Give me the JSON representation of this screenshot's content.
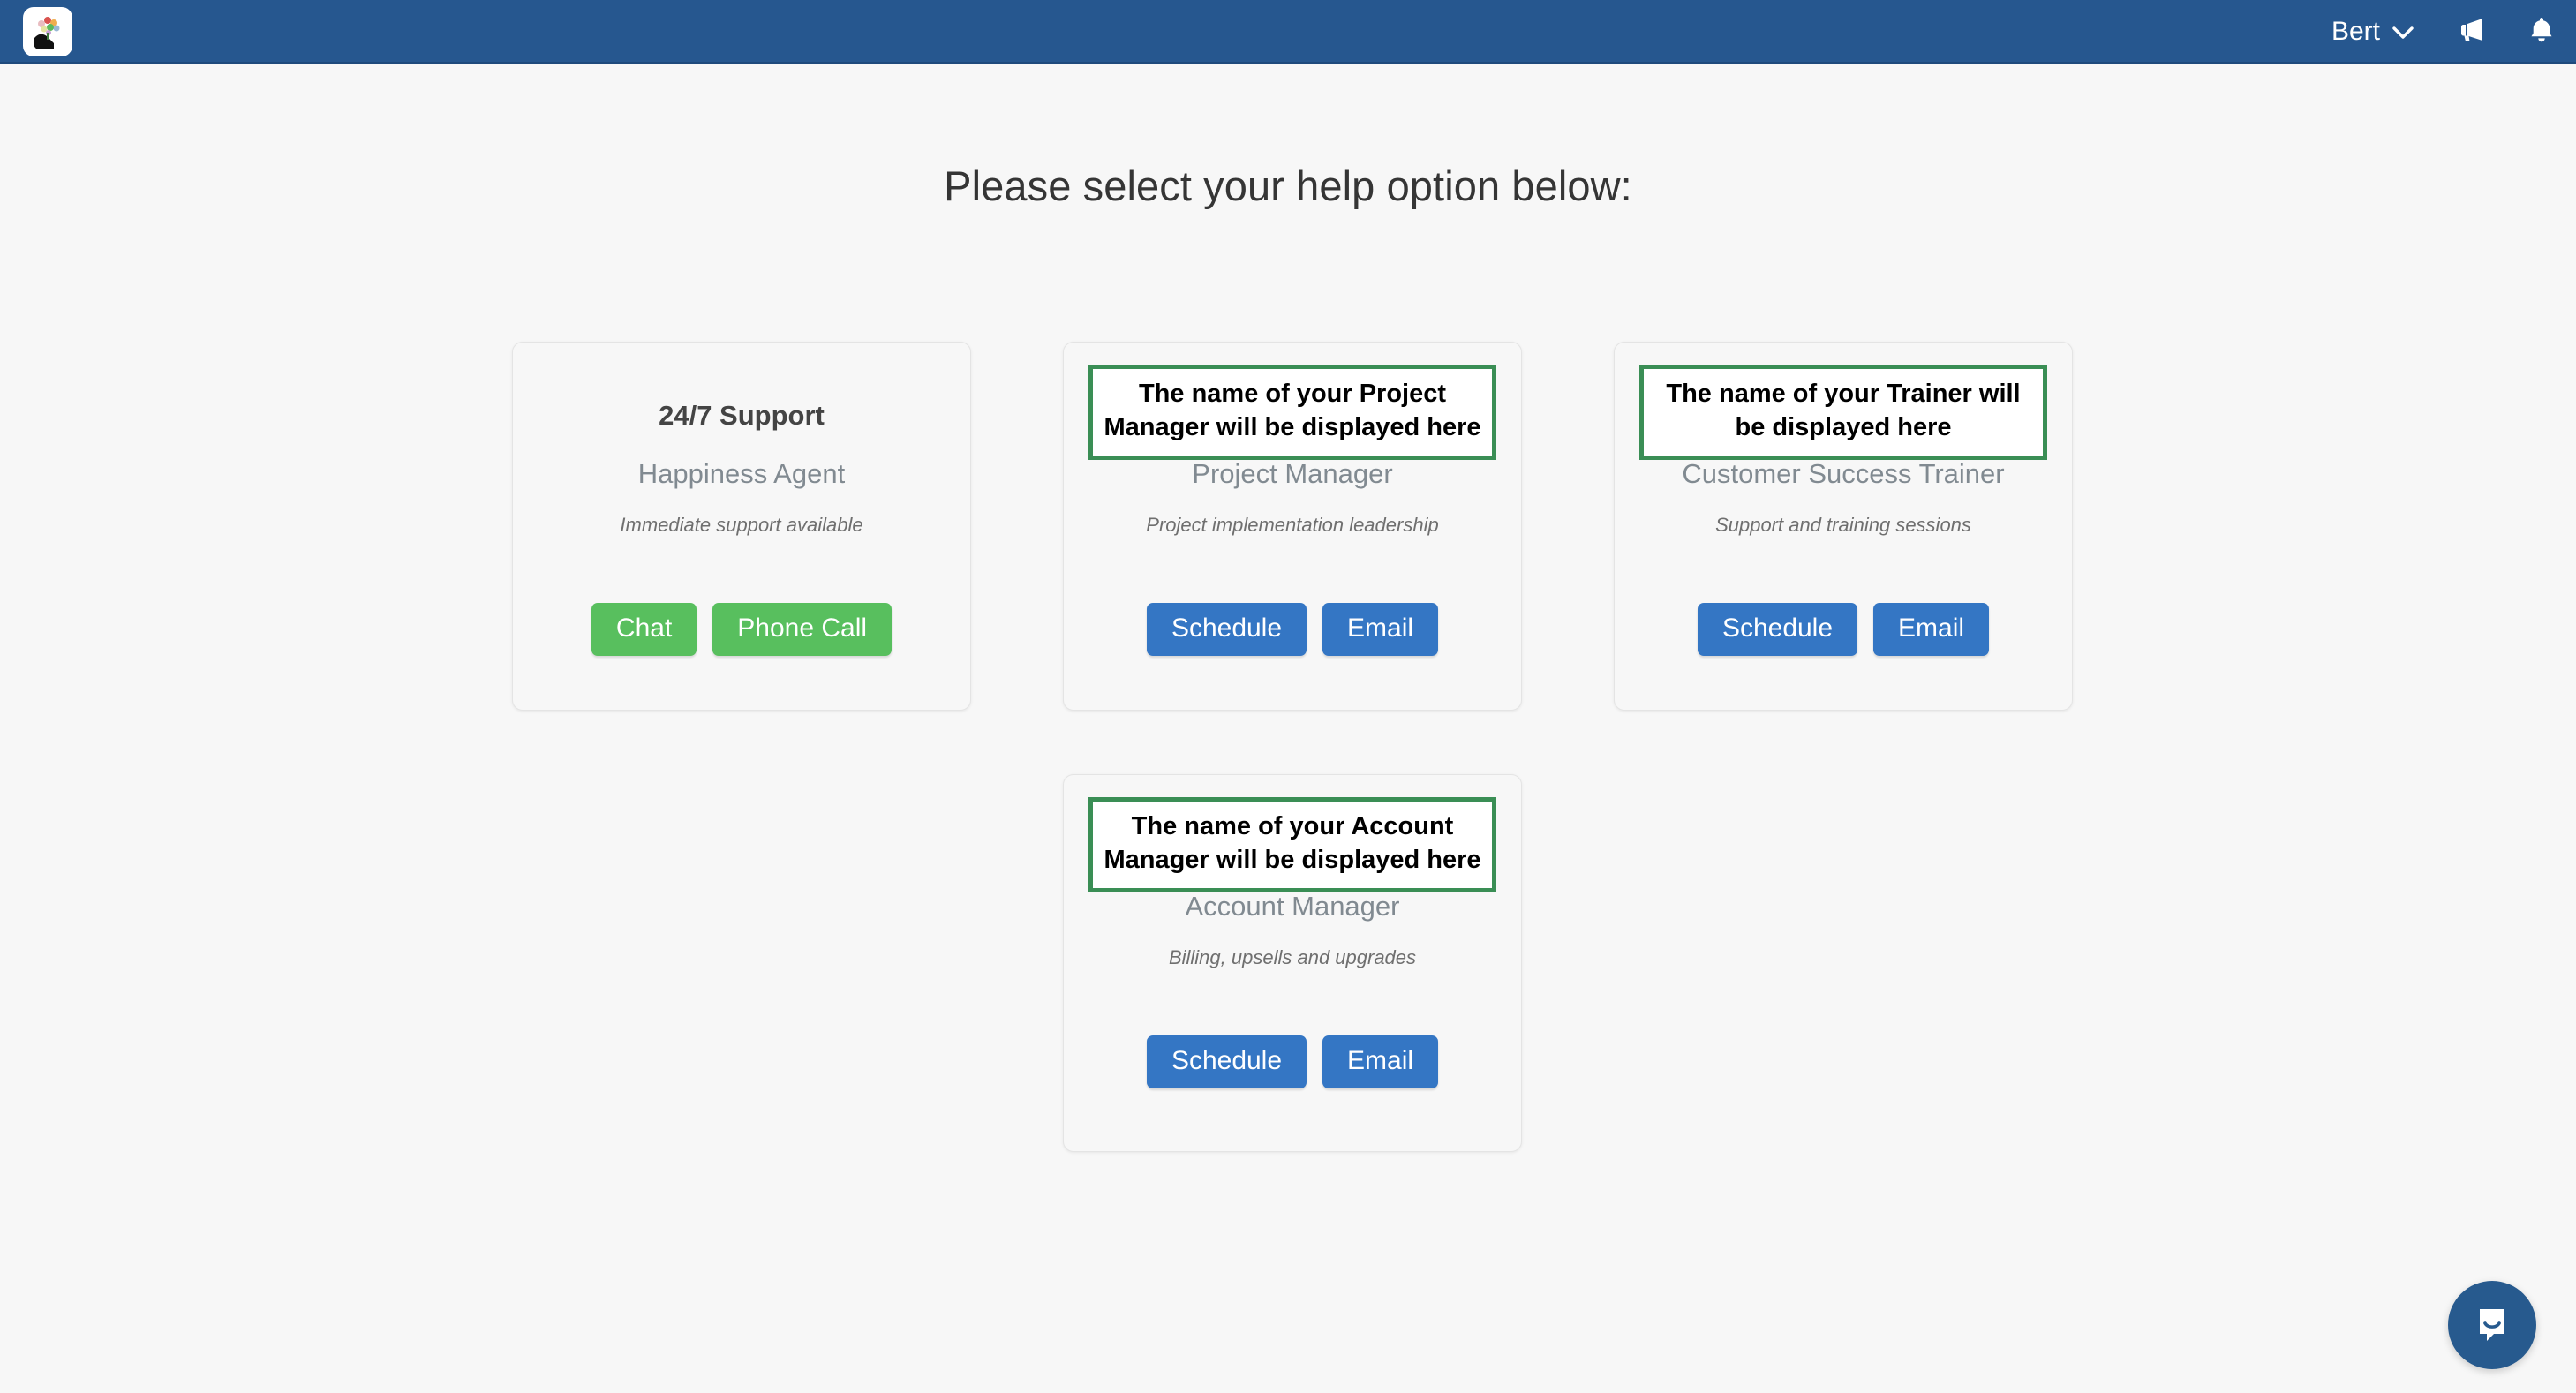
{
  "navbar": {
    "logo_icon": "company-logo-icon",
    "user_name": "Bert",
    "user_chevron_icon": "chevron-down-icon",
    "announcements_icon": "megaphone-icon",
    "notifications_icon": "bell-icon",
    "background_color": "#26578f"
  },
  "page": {
    "title": "Please select your help option below:",
    "background_color": "#f7f7f7"
  },
  "colors": {
    "green_button": "#58bf5e",
    "blue_button": "#3476c4",
    "annotation_border": "#3a8e55",
    "chat_launcher": "#275a8e"
  },
  "cards": [
    {
      "name": "24/7 Support",
      "role": "Happiness Agent",
      "description": "Immediate support available",
      "annotated": false,
      "buttons": [
        {
          "label": "Chat",
          "style": "green"
        },
        {
          "label": "Phone Call",
          "style": "green"
        }
      ]
    },
    {
      "name": "The name of your Project Manager will be displayed here",
      "role": "Project Manager",
      "description": "Project implementation leadership",
      "annotated": true,
      "buttons": [
        {
          "label": "Schedule",
          "style": "blue"
        },
        {
          "label": "Email",
          "style": "blue"
        }
      ]
    },
    {
      "name": "The name of your Trainer will be displayed here",
      "role": "Customer Success Trainer",
      "description": "Support and training sessions",
      "annotated": true,
      "buttons": [
        {
          "label": "Schedule",
          "style": "blue"
        },
        {
          "label": "Email",
          "style": "blue"
        }
      ]
    },
    {
      "name": "The name of your Account Manager will be displayed here",
      "role": "Account Manager",
      "description": "Billing, upsells and upgrades",
      "annotated": true,
      "buttons": [
        {
          "label": "Schedule",
          "style": "blue"
        },
        {
          "label": "Email",
          "style": "blue"
        }
      ]
    }
  ],
  "chat_widget": {
    "icon": "chat-bubble-smile-icon"
  }
}
